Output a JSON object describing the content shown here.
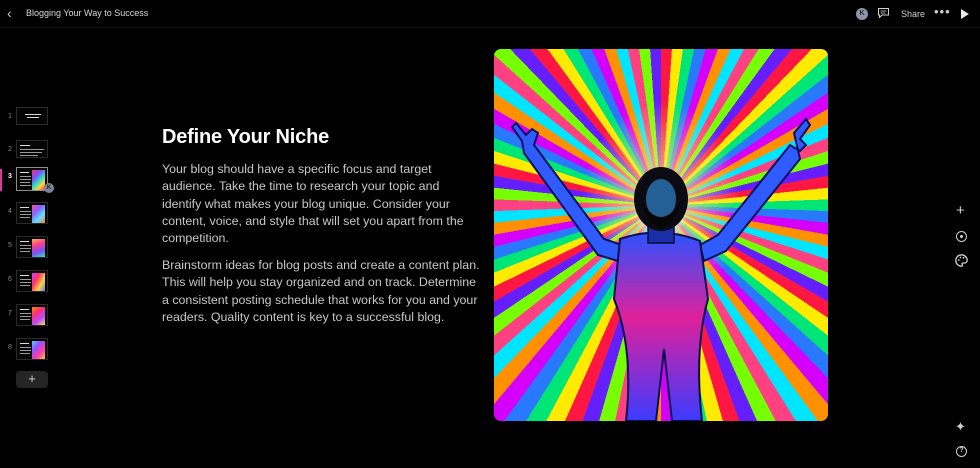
{
  "header": {
    "title": "Blogging Your Way to Success",
    "avatar_initial": "K",
    "share_label": "Share",
    "more_label": "•••"
  },
  "slides": {
    "numbers": [
      "1",
      "2",
      "3",
      "4",
      "5",
      "6",
      "7",
      "8"
    ],
    "active": "3",
    "add_label": "+",
    "badge_initial": "K"
  },
  "content": {
    "heading": "Define Your Niche",
    "paragraph_1": "Your blog should have a specific focus and target audience. Take the time to research your topic and identify what makes your blog unique. Consider your content, voice, and style that will set you apart from the competition.",
    "paragraph_2": "Brainstorm ideas for blog posts and create a content plan. This will help you stay organized and on track. Determine a consistent posting schedule that works for you and your readers. Quality content is key to a successful blog."
  },
  "right_rail": {
    "add_label": "+",
    "help_label": "?"
  },
  "colors": {
    "accent": "#e0389a",
    "background": "#000000"
  }
}
